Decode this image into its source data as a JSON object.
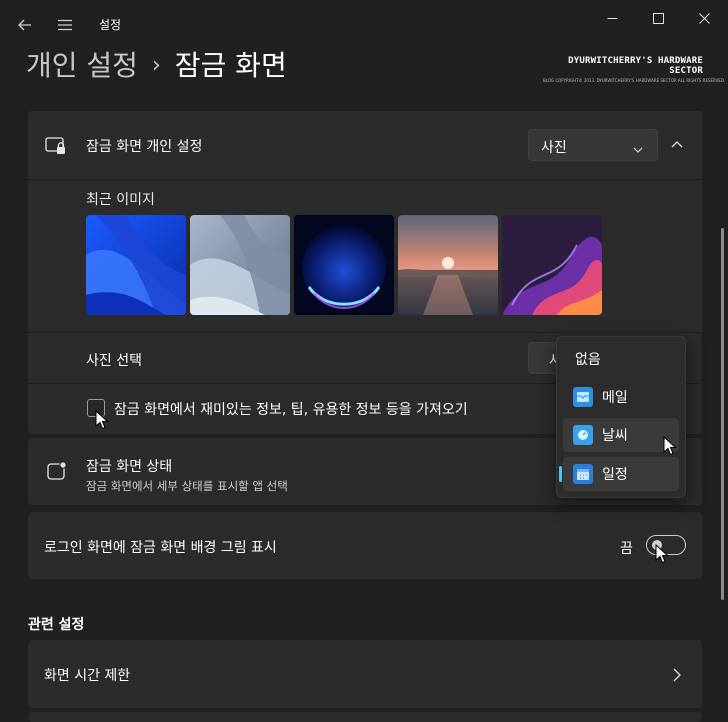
{
  "window": {
    "app_title": "설정",
    "back_icon": "back-arrow-icon",
    "menu_icon": "hamburger-menu-icon",
    "minimize_icon": "minimize-icon",
    "maximize_icon": "maximize-icon",
    "close_icon": "close-icon"
  },
  "breadcrumb": {
    "parent": "개인 설정",
    "separator": "›",
    "current": "잠금 화면"
  },
  "watermark": {
    "line1": "DYURWITCHERRY'S HARDWARE SECTOR",
    "line2": "BLOG COPYRIGHT© 2013. DYURWITCHERRY'S HARDWARE SECTOR ALL RIGHTS RESERVED."
  },
  "lock_personalize": {
    "title": "잠금 화면 개인 설정",
    "dropdown_value": "사진",
    "recent_images_label": "최근 이미지",
    "images": [
      "wallpaper-blue-bloom",
      "wallpaper-light-bloom",
      "wallpaper-glow-orb",
      "wallpaper-sunset",
      "wallpaper-purple-ribbon"
    ],
    "choose_photo_label": "사진 선택",
    "choose_photo_button_partial": "사",
    "fun_facts_label": "잠금 화면에서 재미있는 정보, 팁, 유용한 정보 등을 가져오기"
  },
  "lock_status": {
    "title": "잠금 화면 상태",
    "subtitle": "잠금 화면에서 세부 상태를 표시할 앱 선택"
  },
  "signin_background": {
    "title": "로그인 화면에 잠금 화면 배경 그림 표시",
    "toggle_state": "끔"
  },
  "related": {
    "header": "관련 설정",
    "item": "화면 시간 제한"
  },
  "status_popup": {
    "items": [
      {
        "label": "없음",
        "icon": ""
      },
      {
        "label": "메일",
        "icon": "mail-app-icon"
      },
      {
        "label": "날씨",
        "icon": "weather-app-icon"
      },
      {
        "label": "일정",
        "icon": "calendar-app-icon"
      }
    ]
  },
  "colors": {
    "background": "#202020",
    "card": "#2b2b2b",
    "accent": "#4cc2ff"
  }
}
